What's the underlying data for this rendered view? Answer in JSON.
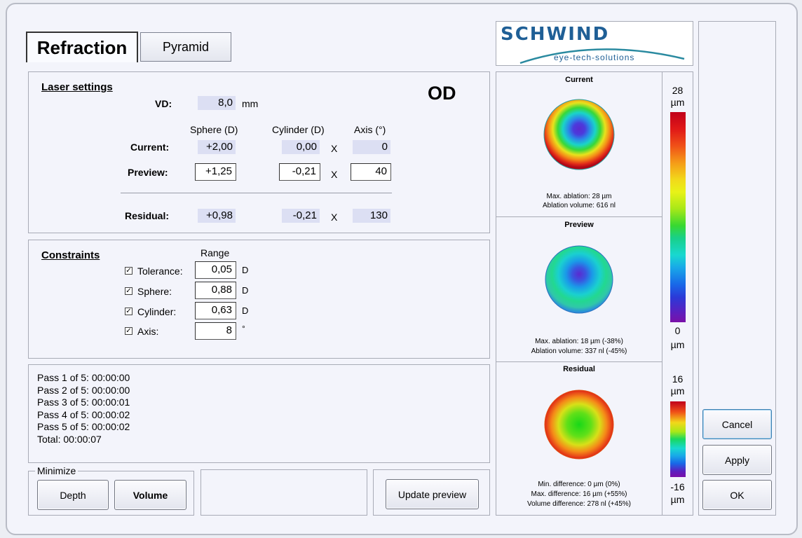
{
  "tabs": {
    "refraction": "Refraction",
    "pyramid": "Pyramid"
  },
  "laser": {
    "heading": "Laser settings",
    "eye": "OD",
    "vd_label": "VD:",
    "vd_value": "8,0",
    "vd_unit": "mm",
    "col_sphere": "Sphere (D)",
    "col_cylinder": "Cylinder (D)",
    "col_axis": "Axis (°)",
    "current_label": "Current:",
    "current": {
      "sphere": "+2,00",
      "cylinder": "0,00",
      "axis": "0"
    },
    "preview_label": "Preview:",
    "preview": {
      "sphere": "+1,25",
      "cylinder": "-0,21",
      "axis": "40"
    },
    "residual_label": "Residual:",
    "residual": {
      "sphere": "+0,98",
      "cylinder": "-0,21",
      "axis": "130"
    },
    "x": "X"
  },
  "constraints": {
    "heading": "Constraints",
    "range_label": "Range",
    "items": [
      {
        "label": "Tolerance:",
        "value": "0,05",
        "unit": "D",
        "checked": true
      },
      {
        "label": "Sphere:",
        "value": "0,88",
        "unit": "D",
        "checked": true
      },
      {
        "label": "Cylinder:",
        "value": "0,63",
        "unit": "D",
        "checked": true
      },
      {
        "label": "Axis:",
        "value": "8",
        "unit": "°",
        "checked": true
      }
    ]
  },
  "timing": [
    "Pass 1 of 5: 00:00:00",
    "Pass 2 of 5: 00:00:00",
    "Pass 3 of 5: 00:00:01",
    "Pass 4 of 5: 00:00:02",
    "Pass 5 of 5: 00:00:02",
    "Total: 00:00:07"
  ],
  "minimize": {
    "legend": "Minimize",
    "depth": "Depth",
    "volume": "Volume"
  },
  "update_preview": "Update preview",
  "logo": {
    "brand": "SCHWIND",
    "tagline": "eye-tech-solutions"
  },
  "maps": {
    "current": {
      "title": "Current",
      "line1": "Max. ablation: 28 µm",
      "line2": "Ablation volume: 616 nl"
    },
    "preview": {
      "title": "Preview",
      "line1": "Max. ablation: 18 µm (-38%)",
      "line2": "Ablation volume: 337 nl (-45%)"
    },
    "residual": {
      "title": "Residual",
      "line1": "Min. difference: 0 µm (0%)",
      "line2": "Max. difference: 16 µm (+55%)",
      "line3": "Volume difference: 278 nl (+45%)"
    }
  },
  "scale_top": {
    "max": "28",
    "max_unit": "µm",
    "min": "0",
    "min_unit": "µm"
  },
  "scale_bottom": {
    "max": "16",
    "max_unit": "µm",
    "min": "-16",
    "min_unit": "µm"
  },
  "buttons": {
    "cancel": "Cancel",
    "apply": "Apply",
    "ok": "OK"
  },
  "colors": {
    "accent_blue": "#1f5f96",
    "logo_teal": "#2a8aa0",
    "readonly_bg": "#dcdff3"
  }
}
